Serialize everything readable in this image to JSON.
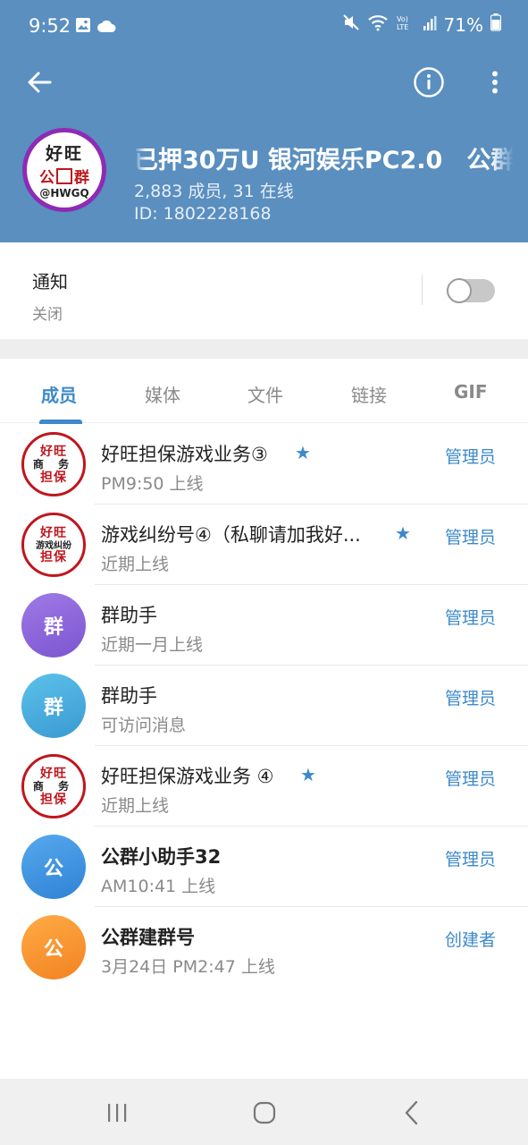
{
  "status_bar": {
    "time": "9:52",
    "battery": "71%"
  },
  "group": {
    "title": "已押30万U 银河娱乐PC2.0　公群",
    "members": "2,883 成员, 31 在线",
    "id": "ID: 1802228168",
    "avatar": {
      "line1": "好旺",
      "line2a": "公",
      "line2b": "群",
      "line3": "@HWGQ"
    }
  },
  "notification": {
    "title": "通知",
    "status": "关闭",
    "enabled": false
  },
  "tabs": [
    {
      "label": "成员",
      "active": true
    },
    {
      "label": "媒体",
      "active": false
    },
    {
      "label": "文件",
      "active": false
    },
    {
      "label": "链接",
      "active": false
    },
    {
      "label": "GIF",
      "active": false
    }
  ],
  "members": [
    {
      "name": "好旺担保游戏业务③",
      "status": "PM9:50 上线",
      "role": "管理员",
      "star": true,
      "avatar": {
        "type": "stamp",
        "l1": "好旺",
        "l2": "商 务",
        "l3": "担保"
      }
    },
    {
      "name": "游戏纠纷号④（私聊请加我好...",
      "status": "近期上线",
      "role": "管理员",
      "star": true,
      "avatar": {
        "type": "stamp",
        "l1": "好旺",
        "l2": "游戏纠纷",
        "l3": "担保"
      }
    },
    {
      "name": "群助手",
      "status": "近期一月上线",
      "role": "管理员",
      "star": false,
      "avatar": {
        "type": "letter",
        "text": "群",
        "color": "#8a63d2"
      }
    },
    {
      "name": "群助手",
      "status": "可访问消息",
      "role": "管理员",
      "star": false,
      "avatar": {
        "type": "letter",
        "text": "群",
        "color": "#41a9d9"
      }
    },
    {
      "name": "好旺担保游戏业务 ④",
      "status": "近期上线",
      "role": "管理员",
      "star": true,
      "avatar": {
        "type": "stamp",
        "l1": "好旺",
        "l2": "商 务",
        "l3": "担保"
      }
    },
    {
      "name": "公群小助手32",
      "status": "AM10:41 上线",
      "role": "管理员",
      "star": false,
      "avatar": {
        "type": "letter",
        "text": "公",
        "color": "#3b8fde"
      }
    },
    {
      "name": "公群建群号",
      "status": "3月24日 PM2:47 上线",
      "role": "创建者",
      "star": false,
      "avatar": {
        "type": "letter",
        "text": "公",
        "color": "#f6922e"
      }
    }
  ]
}
